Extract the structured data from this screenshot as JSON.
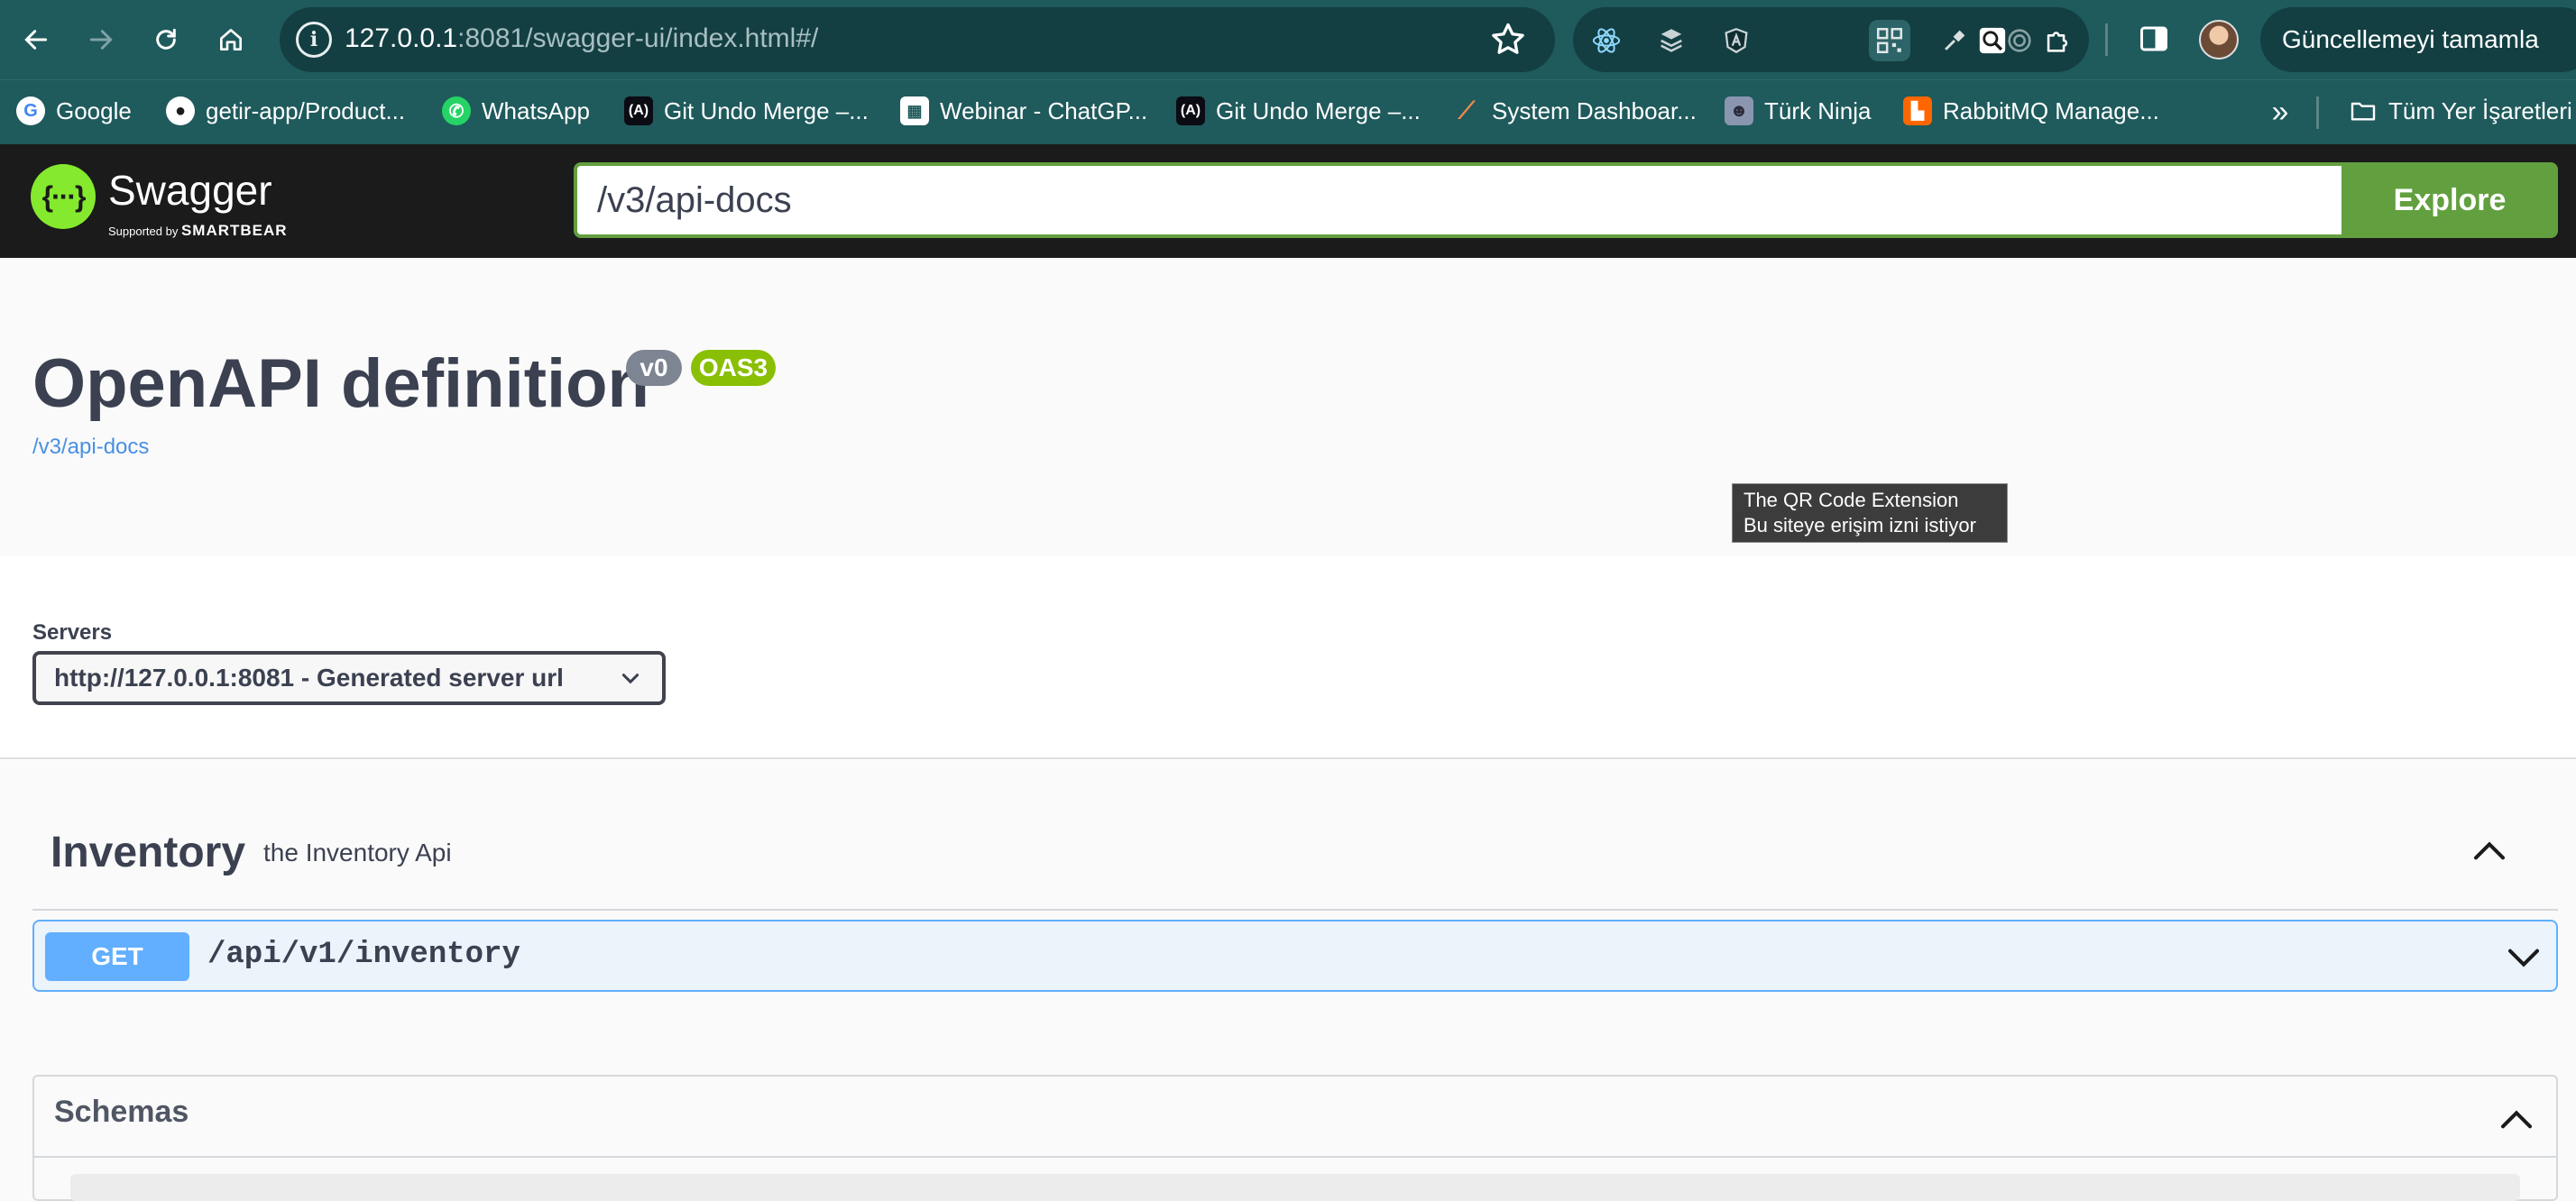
{
  "browser": {
    "url_host": "127.0.0.1",
    "url_rest": ":8081/swagger-ui/index.html#/",
    "update_label": "Güncellemeyi tamamla",
    "extensions": [
      "react-devtools-icon",
      "layers-extension-icon",
      "angular-devtools-icon",
      "qr-code-extension-icon",
      "broom-extension-icon",
      "spiral-extension-icon",
      "magnifier-extension-icon",
      "puzzle-extensions-icon"
    ]
  },
  "bookmarks": {
    "items": [
      {
        "label": "Google",
        "icon": "google-icon"
      },
      {
        "label": "getir-app/Product...",
        "icon": "github-icon"
      },
      {
        "label": "WhatsApp",
        "icon": "whatsapp-icon"
      },
      {
        "label": "Git Undo Merge –...",
        "icon": "site-icon"
      },
      {
        "label": "Webinar - ChatGP...",
        "icon": "calendar-icon"
      },
      {
        "label": "Git Undo Merge –...",
        "icon": "site-icon"
      },
      {
        "label": "System Dashboar...",
        "icon": "tool-icon"
      },
      {
        "label": "Türk Ninja",
        "icon": "ninja-icon"
      },
      {
        "label": "RabbitMQ Manage...",
        "icon": "rabbitmq-icon"
      }
    ],
    "all_bookmarks": "Tüm Yer İşaretleri"
  },
  "swagger": {
    "brand": "Swagger",
    "supported_by": "Supported by",
    "smartbear": "SMARTBEAR",
    "spec_url": "/v3/api-docs",
    "explore_label": "Explore"
  },
  "info": {
    "title": "OpenAPI definition",
    "version": "v0",
    "oas": "OAS3",
    "link": "/v3/api-docs"
  },
  "tooltip": {
    "line1": "The QR Code Extension",
    "line2": "Bu siteye erişim izni istiyor"
  },
  "servers": {
    "label": "Servers",
    "selected": "http://127.0.0.1:8081 - Generated server url"
  },
  "tag": {
    "name": "Inventory",
    "description": "the Inventory Api",
    "operations": [
      {
        "method": "GET",
        "path": "/api/v1/inventory",
        "color": "#61affe"
      }
    ]
  },
  "schemas": {
    "title": "Schemas"
  },
  "colors": {
    "browser_bar": "#1f5a5c",
    "swagger_header": "#1b1b1b",
    "explore_green": "#62a03f",
    "oas_badge": "#89bf04",
    "get_blue": "#61affe"
  }
}
